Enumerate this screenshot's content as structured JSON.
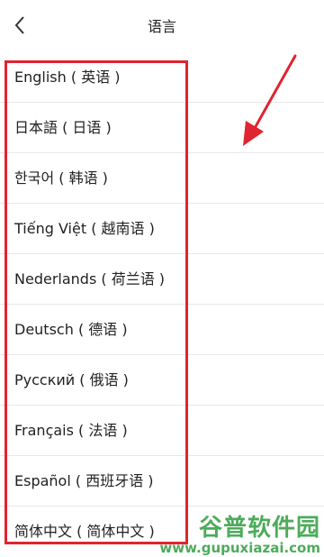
{
  "header": {
    "title": "语言",
    "back_icon": "chevron-left-icon"
  },
  "languages": [
    {
      "label": "English ( 英语 )"
    },
    {
      "label": "日本語 ( 日语 )"
    },
    {
      "label": "한국어 ( 韩语 )"
    },
    {
      "label": "Tiếng Việt ( 越南语 )"
    },
    {
      "label": "Nederlands ( 荷兰语 )"
    },
    {
      "label": "Deutsch ( 德语 )"
    },
    {
      "label": "Русский ( 俄语 )"
    },
    {
      "label": "Français ( 法语 )"
    },
    {
      "label": "Español ( 西班牙语 )"
    },
    {
      "label": "简体中文 ( 简体中文 )"
    }
  ],
  "annotation": {
    "box_color": "#e02430",
    "arrow_color": "#e02430"
  },
  "watermark": {
    "main": "谷普软件园",
    "url": "www.gupuxiazai.com",
    "color": "#3aa34a"
  }
}
